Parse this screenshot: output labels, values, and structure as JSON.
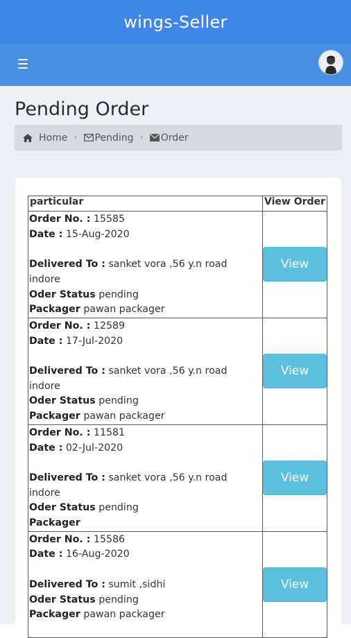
{
  "app": {
    "title": "wings-Seller"
  },
  "nav": {
    "menu_icon": "hamburger-icon",
    "avatar_icon": "user-avatar"
  },
  "page": {
    "title": "Pending Order"
  },
  "breadcrumb": [
    {
      "label": "Home",
      "icon": "home-icon"
    },
    {
      "label": "Pending",
      "icon": "envelope-outline-icon"
    },
    {
      "label": "Order",
      "icon": "envelope-icon"
    }
  ],
  "table": {
    "headers": {
      "particular": "particular",
      "view_order": "View Order"
    },
    "labels": {
      "order_no": "Order No. :",
      "date": "Date :",
      "delivered_to": "Delivered To :",
      "status": "Oder Status",
      "packager": "Packager"
    },
    "view_label": "View",
    "rows": [
      {
        "order_no": "15585",
        "date": "15-Aug-2020",
        "delivered_to": "sanket vora ,56 y.n road",
        "city": "indore",
        "status": "pending",
        "packager": "pawan packager"
      },
      {
        "order_no": "12589",
        "date": "17-Jul-2020",
        "delivered_to": "sanket vora ,56 y.n road",
        "city": "indore",
        "status": "pending",
        "packager": "pawan packager"
      },
      {
        "order_no": "11581",
        "date": "02-Jul-2020",
        "delivered_to": "sanket vora ,56 y.n road",
        "city": "indore",
        "status": "pending",
        "packager": ""
      },
      {
        "order_no": "15586",
        "date": "16-Aug-2020",
        "delivered_to": "sumit ,sidhi",
        "city": "",
        "status": "pending",
        "packager": "pawan packager"
      }
    ]
  },
  "colors": {
    "brand": "#3f86e6",
    "nav": "#4a90e2",
    "button": "#5bc0de",
    "background": "#edf1f5"
  }
}
